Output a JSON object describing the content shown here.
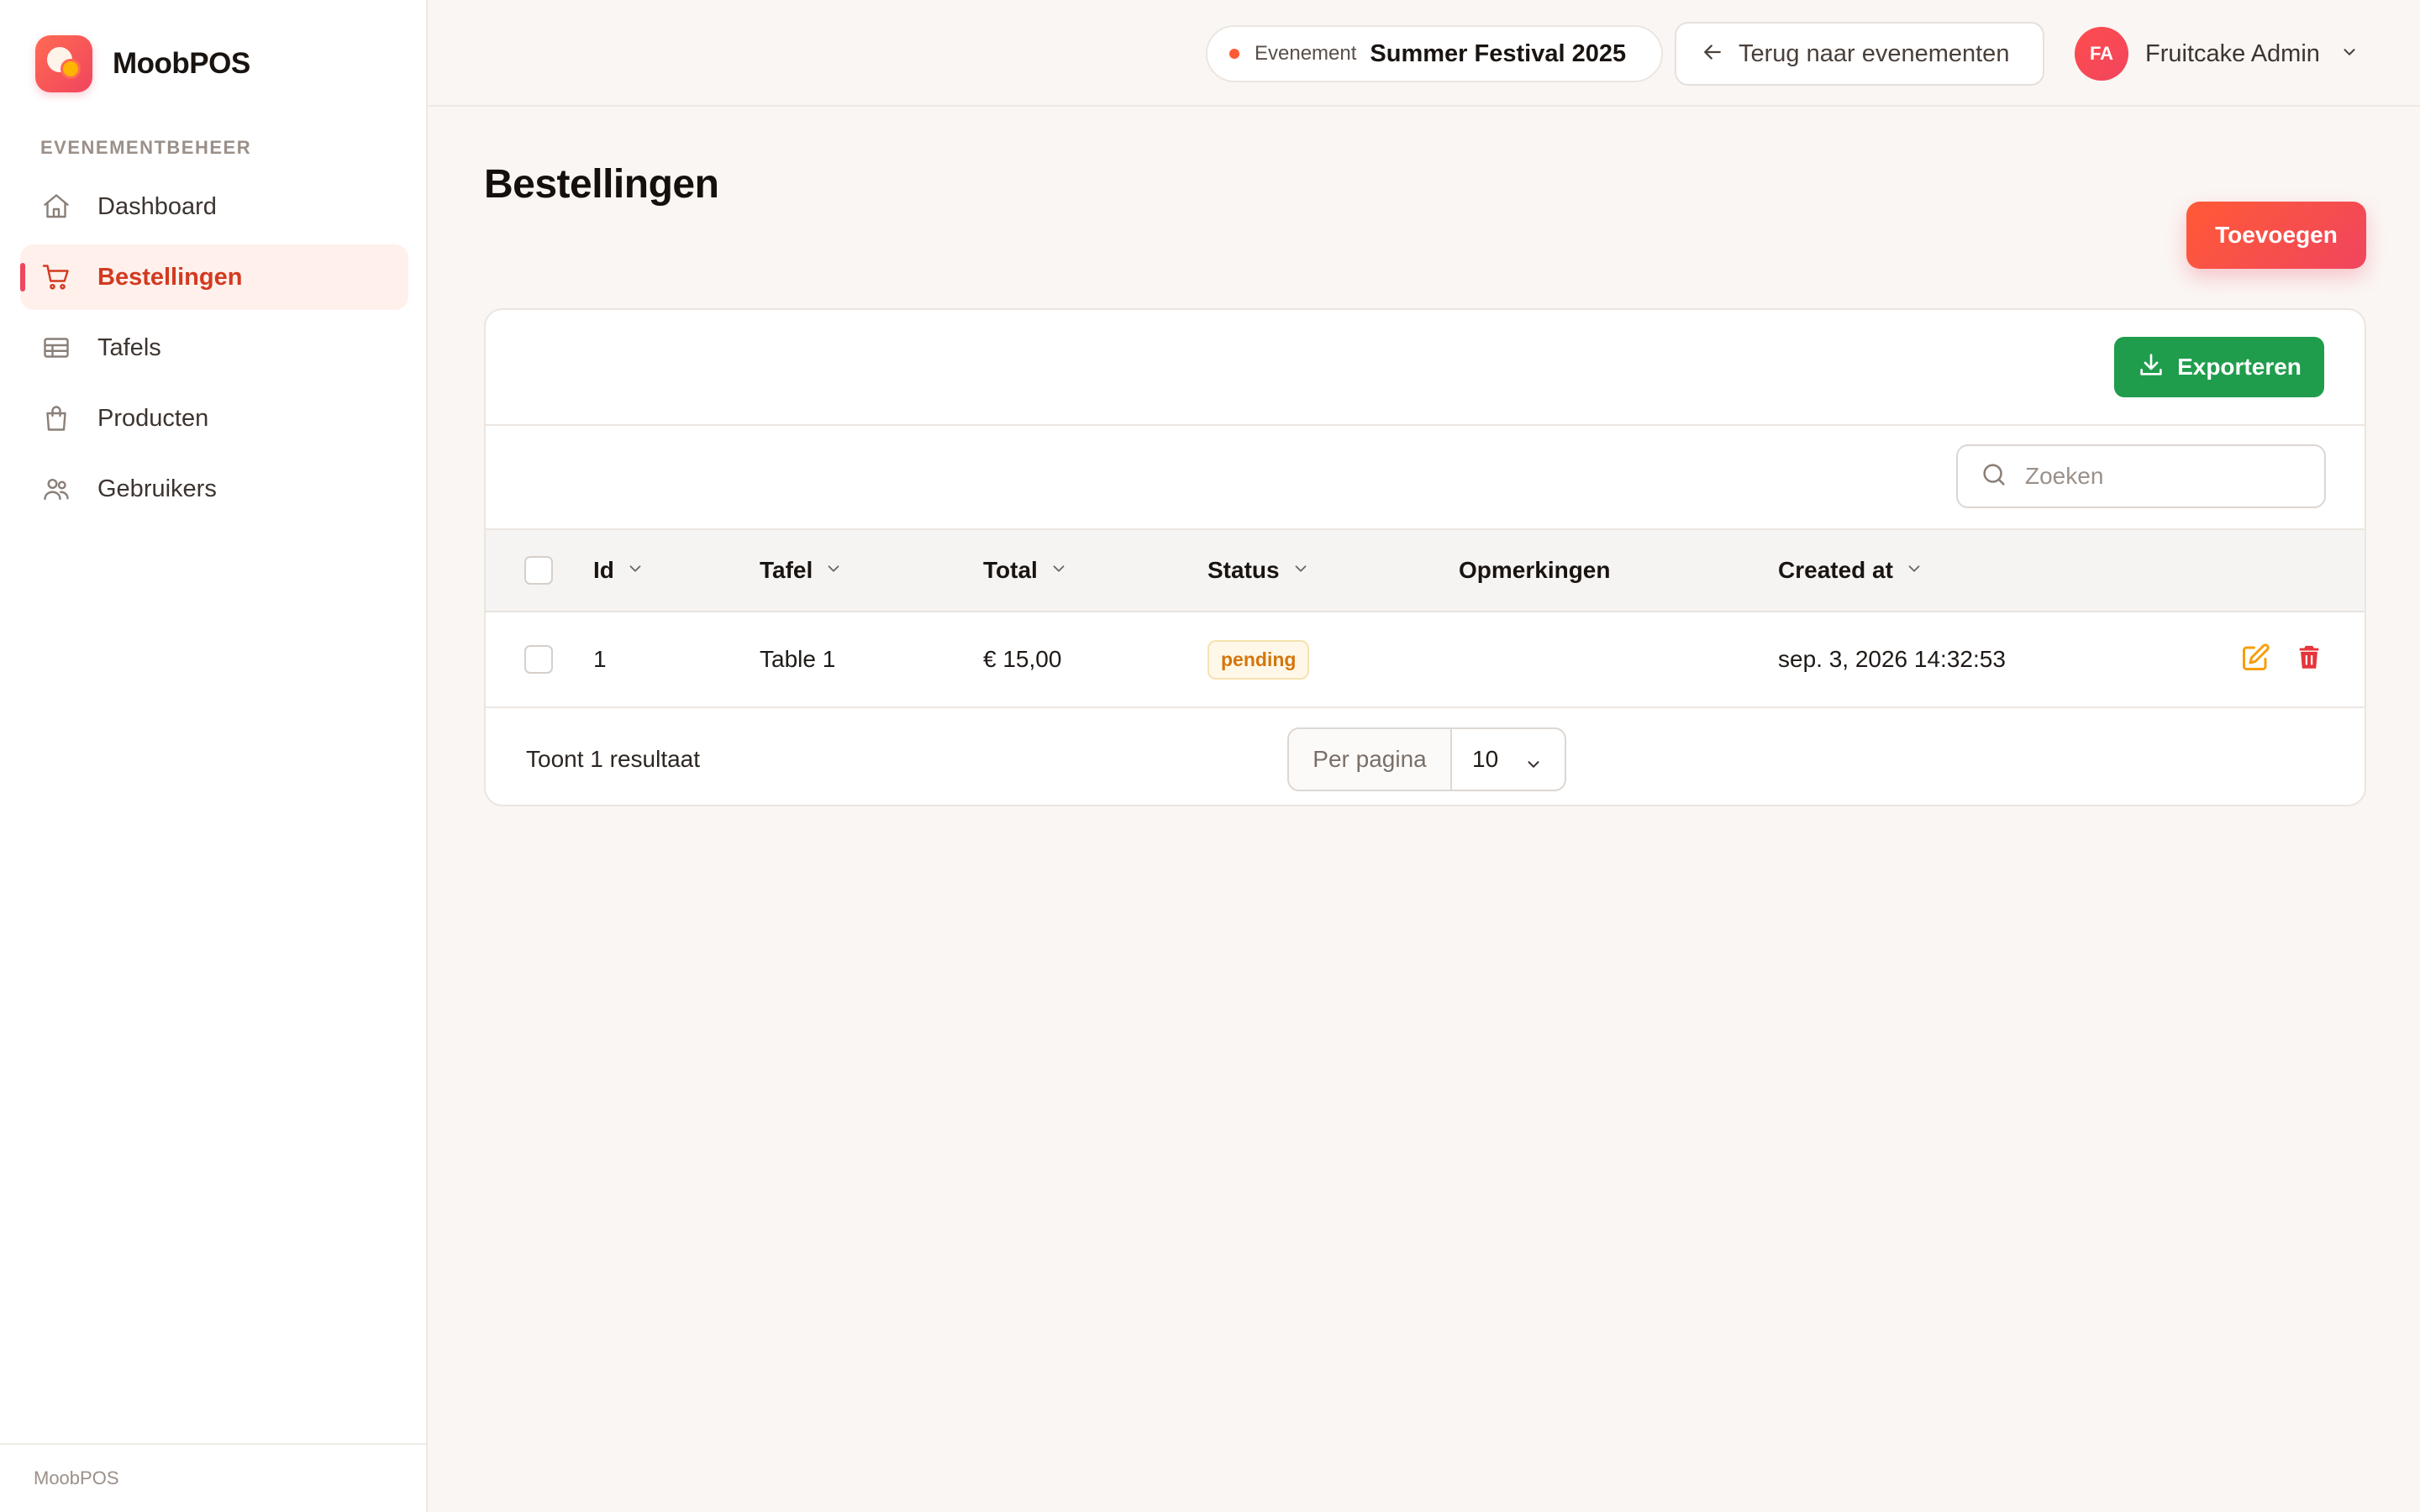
{
  "brand": {
    "name": "MoobPOS"
  },
  "sidebar": {
    "section_label": "EVENEMENTBEHEER",
    "items": [
      {
        "label": "Dashboard",
        "icon": "home-icon",
        "active": false
      },
      {
        "label": "Bestellingen",
        "icon": "cart-icon",
        "active": true
      },
      {
        "label": "Tafels",
        "icon": "table-icon",
        "active": false
      },
      {
        "label": "Producten",
        "icon": "bag-icon",
        "active": false
      },
      {
        "label": "Gebruikers",
        "icon": "users-icon",
        "active": false
      }
    ],
    "footer": "MoobPOS"
  },
  "topbar": {
    "event_label": "Evenement",
    "event_name": "Summer Festival 2025",
    "back_label": "Terug naar evenementen",
    "user_initials": "FA",
    "user_name": "Fruitcake Admin"
  },
  "page": {
    "title": "Bestellingen",
    "add_label": "Toevoegen",
    "export_label": "Exporteren",
    "search_placeholder": "Zoeken"
  },
  "table": {
    "columns": {
      "id": "Id",
      "tafel": "Tafel",
      "total": "Total",
      "status": "Status",
      "opmerkingen": "Opmerkingen",
      "created_at": "Created at"
    },
    "rows": [
      {
        "id": "1",
        "tafel": "Table 1",
        "total": "€ 15,00",
        "status": "pending",
        "opmerkingen": "",
        "created_at": "sep. 3, 2026 14:32:53"
      }
    ],
    "results_text": "Toont 1 resultaat",
    "per_page_label": "Per pagina",
    "per_page_value": "10"
  },
  "colors": {
    "accent": "#f0455e",
    "accent_orange": "#ff5a36",
    "export_green": "#1f9d4c",
    "edit_orange": "#f59e0b",
    "delete_red": "#e5343a",
    "status_pending": "#d4760c"
  }
}
